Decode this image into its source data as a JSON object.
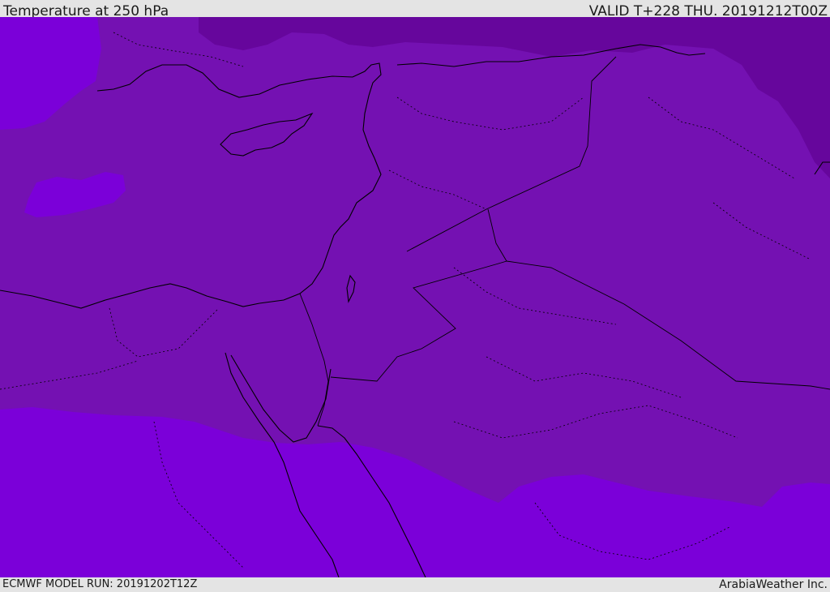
{
  "header": {
    "title": "Temperature at 250 hPa",
    "valid": "VALID T+228 THU. 20191212T00Z"
  },
  "footer": {
    "model_run": "ECMWF MODEL RUN: 20191202T12Z",
    "credit": "ArabiaWeather Inc."
  },
  "colors": {
    "band_warm": "#7b00d9",
    "band_mid": "#7411b2",
    "band_cold": "#66069c",
    "border": "#000000"
  }
}
